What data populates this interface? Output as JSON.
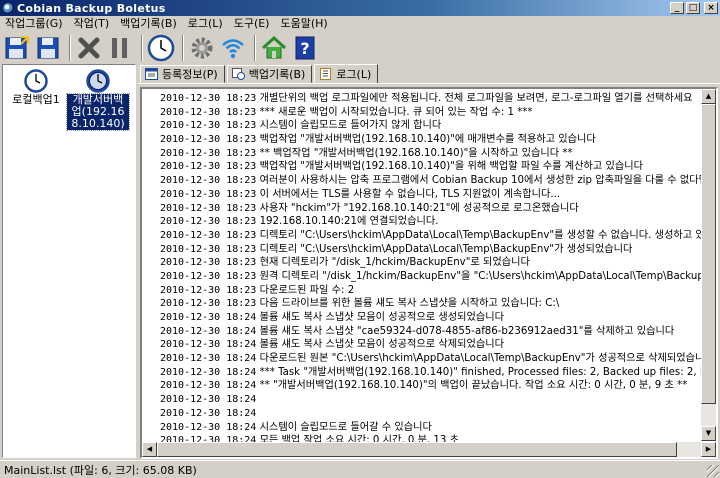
{
  "window": {
    "title": "Cobian Backup Boletus"
  },
  "menu": [
    "작업그룹(G)",
    "작업(T)",
    "백업기록(B)",
    "로그(L)",
    "도구(E)",
    "도움말(H)"
  ],
  "toolbar": {
    "icons": [
      "save-as-icon",
      "save-icon",
      "delete-icon",
      "pause-icon",
      "clock-icon",
      "settings-icon",
      "wifi-icon",
      "home-icon",
      "help-icon"
    ]
  },
  "tasks": [
    {
      "label": "로컬백업1",
      "selected": false
    },
    {
      "label": "개발서버백업(192.168.10.140)",
      "selected": true
    }
  ],
  "tabs": [
    {
      "label": "등록정보(P)",
      "active": false
    },
    {
      "label": "백업기록(B)",
      "active": false
    },
    {
      "label": "로그(L)",
      "active": true
    }
  ],
  "log": [
    {
      "ts": "2010-12-30 18:23",
      "msg": "개별단위의 백업 로그파일에만 적용됩니다. 전체 로그파일을 보려면, 로그-로그파일 열기를 선택하세요"
    },
    {
      "ts": "2010-12-30 18:23",
      "msg": "*** 새로운 백업이 시작되었습니다. 큐 되어 있는 작업 수: 1 ***"
    },
    {
      "ts": "2010-12-30 18:23",
      "msg": "시스템이 슬립모드로 들어가지 않게 합니다"
    },
    {
      "ts": "2010-12-30 18:23",
      "msg": "백업작업 \"개발서버백업(192.168.10.140)\"에 매개변수를 적용하고 있습니다"
    },
    {
      "ts": "2010-12-30 18:23",
      "msg": "** 백업작업 \"개발서버백업(192.168.10.140)\"을 시작하고 있습니다 **"
    },
    {
      "ts": "2010-12-30 18:23",
      "msg": "백업작업 \"개발서버백업(192.168.10.140)\"을 위해 백업할 파일 수를 계산하고 있습니다"
    },
    {
      "ts": "2010-12-30 18:23",
      "msg": "여러분이 사용하시는 압축 프로그램에서 Cobian Backup 10에서 생성한 zip 압축파일을 다룰 수 없다면, FA"
    },
    {
      "ts": "2010-12-30 18:23",
      "msg": "이 서버에서는 TLS를 사용할 수 없습니다, TLS 지원없이 계속합니다..."
    },
    {
      "ts": "2010-12-30 18:23",
      "msg": "사용자 \"hckim\"가 \"192.168.10.140:21\"에 성공적으로 로그온했습니다"
    },
    {
      "ts": "2010-12-30 18:23",
      "msg": "192.168.10.140:21에 연결되었습니다."
    },
    {
      "ts": "2010-12-30 18:23",
      "msg": "디렉토리 \"C:\\Users\\hckim\\AppData\\Local\\Temp\\BackupEnv\"를 생성할 수 없습니다. 생성하고 있습"
    },
    {
      "ts": "2010-12-30 18:23",
      "msg": "디렉토리 \"C:\\Users\\hckim\\AppData\\Local\\Temp\\BackupEnv\"가 생성되었습니다"
    },
    {
      "ts": "2010-12-30 18:23",
      "msg": "현재 디렉토리가 \"/disk_1/hckim/BackupEnv\"로 되었습니다"
    },
    {
      "ts": "2010-12-30 18:23",
      "msg": "원격 디렉토리 \"/disk_1/hckim/BackupEnv\"을 \"C:\\Users\\hckim\\AppData\\Local\\Temp\\BackupEnv"
    },
    {
      "ts": "2010-12-30 18:23",
      "msg": "다운로드된 파일 수: 2"
    },
    {
      "ts": "2010-12-30 18:23",
      "msg": "다음 드라이브를 위한 볼륨 섀도 복사 스냅샷을 시작하고 있습니다: C:\\"
    },
    {
      "ts": "2010-12-30 18:24",
      "msg": "볼륨 섀도 복사 스냅샷 모음이 성공적으로 생성되었습니다"
    },
    {
      "ts": "2010-12-30 18:24",
      "msg": "볼륨 섀도 복사 스냅샷 \"cae59324-d078-4855-af86-b236912aed31\"를 삭제하고 있습니다"
    },
    {
      "ts": "2010-12-30 18:24",
      "msg": "볼륨 섀도 복사 스냅샷 모음이 성공적으로 삭제되었습니다"
    },
    {
      "ts": "2010-12-30 18:24",
      "msg": "다운로드된 원본 \"C:\\Users\\hckim\\AppData\\Local\\Temp\\BackupEnv\"가 성공적으로 삭제되었습니다"
    },
    {
      "ts": "2010-12-30 18:24",
      "msg": "*** Task \"개발서버백업(192.168.10.140)\" finished, Processed files: 2, Backed up files: 2, Errors: 0 ***"
    },
    {
      "ts": "2010-12-30 18:24",
      "msg": "** \"개발서버백업(192.168.10.140)\"의 백업이 끝났습니다. 작업 소요 시간: 0 시간, 0 분, 9 초 **"
    },
    {
      "ts": "2010-12-30 18:24",
      "msg": ""
    },
    {
      "ts": "2010-12-30 18:24",
      "msg": ""
    },
    {
      "ts": "2010-12-30 18:24",
      "msg": "시스템이 슬립모드로 들어갈 수 있습니다"
    },
    {
      "ts": "2010-12-30 18:24",
      "msg": "모든 백업 작업 소요 시간: 0 시간, 0 분, 13 초"
    },
    {
      "ts": "2010-12-30 18:24",
      "msg": "*** 백업이 끝났습니다. 처리된 파일: 2, 백업된 파일: 2, 오류: 0 ***"
    }
  ],
  "status": {
    "text": "MainList.lst (파일: 6, 크기: 65.08 KB)"
  }
}
